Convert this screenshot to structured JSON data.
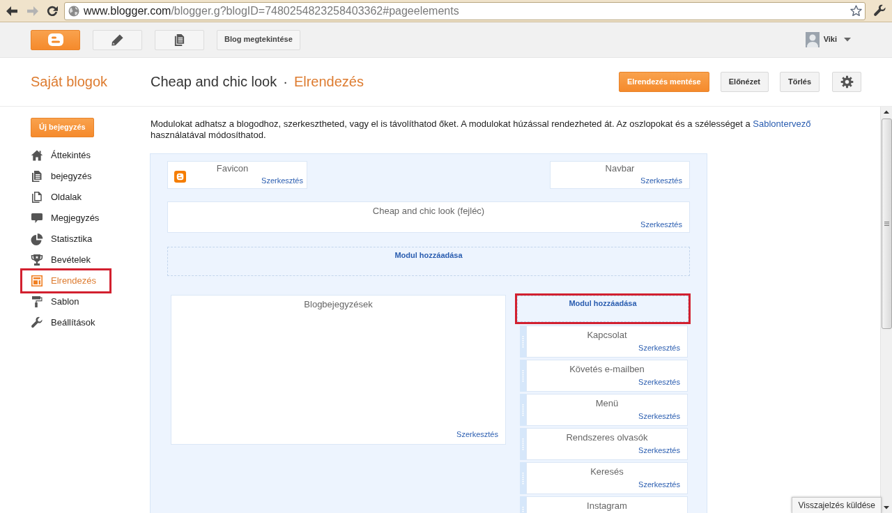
{
  "browser": {
    "url": "www.blogger.com/blogger.g?blogID=7480254823258403362#pageelements",
    "back_disabled": false,
    "forward_disabled": true
  },
  "top_bar": {
    "view_blog_button": "Blog megtekintése",
    "user_name": "Viki"
  },
  "header": {
    "title": "Saját blogok",
    "blog_name": "Cheap and chic look",
    "separator": "·",
    "page_title": "Elrendezés",
    "buttons": [
      {
        "label": "Elrendezés mentése",
        "primary": true
      },
      {
        "label": "Előnézet",
        "primary": false
      },
      {
        "label": "Törlés",
        "primary": false
      }
    ]
  },
  "sidebar": {
    "new_post_button": "Új bejegyzés",
    "items": [
      {
        "label": "Áttekintés",
        "selected": false,
        "highlighted": false
      },
      {
        "label": "bejegyzés",
        "selected": false,
        "highlighted": false
      },
      {
        "label": "Oldalak",
        "selected": false,
        "highlighted": false
      },
      {
        "label": "Megjegyzés",
        "selected": false,
        "highlighted": false
      },
      {
        "label": "Statisztika",
        "selected": false,
        "highlighted": false
      },
      {
        "label": "Bevételek",
        "selected": false,
        "highlighted": false
      },
      {
        "label": "Elrendezés",
        "selected": true,
        "highlighted": true
      },
      {
        "label": "Sablon",
        "selected": false,
        "highlighted": false
      },
      {
        "label": "Beállítások",
        "selected": false,
        "highlighted": false
      }
    ]
  },
  "intro": {
    "text_before": "Modulokat adhatsz a blogodhoz, szerkesztheted, vagy el is távolíthatod őket. A modulokat húzással rendezheted át. Az oszlopokat és a szélességet a",
    "link": "Sablontervező",
    "text_after": "használatával módosíthatod."
  },
  "layout": {
    "top_widgets": [
      {
        "title": "Favicon",
        "edit": "Szerkesztés"
      },
      {
        "title": "Navbar",
        "edit": "Szerkesztés"
      }
    ],
    "header_widget": {
      "title": "Cheap and chic look (fejléc)",
      "edit": "Szerkesztés"
    },
    "add_module": {
      "label": "Modul hozzáadása",
      "highlighted": false
    },
    "main_column": {
      "widgets": [
        {
          "title": "Blogbejegyzések",
          "edit": "Szerkesztés"
        }
      ]
    },
    "side_column": {
      "add_module": {
        "label": "Modul hozzáadása",
        "highlighted": true
      },
      "widgets": [
        {
          "title": "Kapcsolat",
          "edit": "Szerkesztés"
        },
        {
          "title": "Követés e-mailben",
          "edit": "Szerkesztés"
        },
        {
          "title": "Menü",
          "edit": "Szerkesztés"
        },
        {
          "title": "Rendszeres olvasók",
          "edit": "Szerkesztés"
        },
        {
          "title": "Keresés",
          "edit": "Szerkesztés"
        },
        {
          "title": "Instagram"
        }
      ]
    }
  },
  "feedback_button": "Visszajelzés küldése"
}
